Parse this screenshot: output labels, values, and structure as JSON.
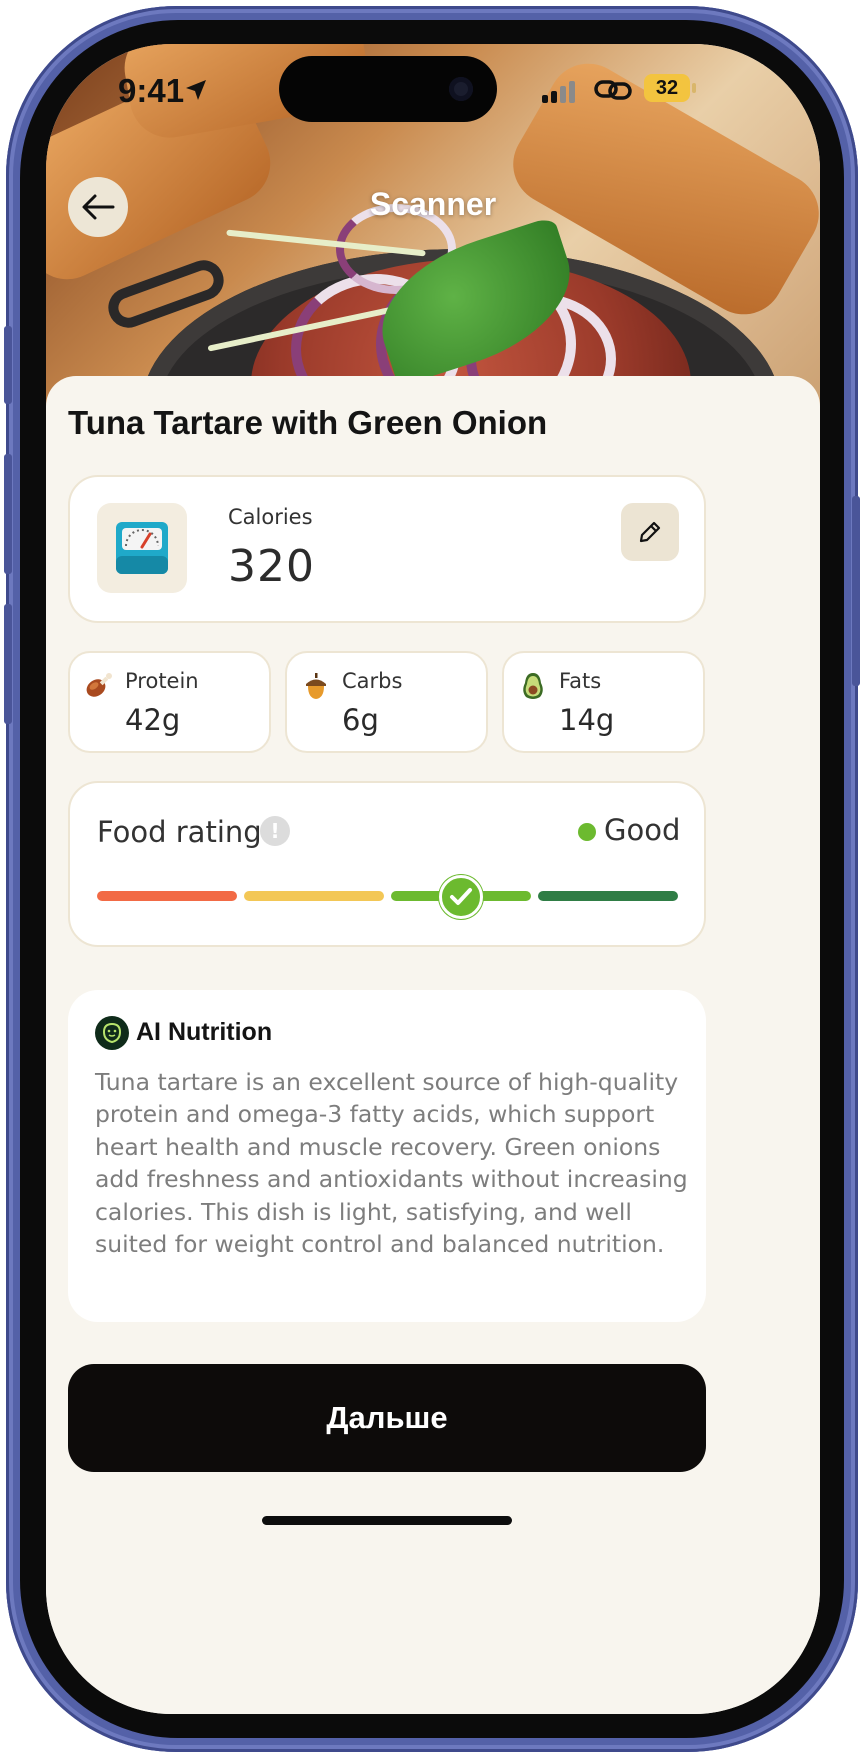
{
  "status_bar": {
    "time": "9:41",
    "battery": "32"
  },
  "header": {
    "title": "Scanner"
  },
  "dish": {
    "name": "Tuna Tartare with Green Onion"
  },
  "calories": {
    "label": "Calories",
    "value": "320"
  },
  "macros": [
    {
      "label": "Protein",
      "value": "42g",
      "icon": "drumstick-icon"
    },
    {
      "label": "Carbs",
      "value": "6g",
      "icon": "acorn-icon"
    },
    {
      "label": "Fats",
      "value": "14g",
      "icon": "avocado-icon"
    }
  ],
  "food_rating": {
    "label": "Food rating",
    "rating": "Good",
    "level_index": 3,
    "levels": 4,
    "colors": [
      "#f26a45",
      "#f3c756",
      "#6cba2f",
      "#2f7d45"
    ]
  },
  "ai_nutrition": {
    "title": "AI Nutrition",
    "text": "Tuna tartare is an excellent source of high-quality protein and omega-3 fatty acids, which support heart health and muscle recovery. Green onions add freshness and antioxidants without increasing calories. This dish is light, satisfying, and well suited for weight control and balanced nutrition."
  },
  "cta": {
    "label": "Дальше"
  }
}
